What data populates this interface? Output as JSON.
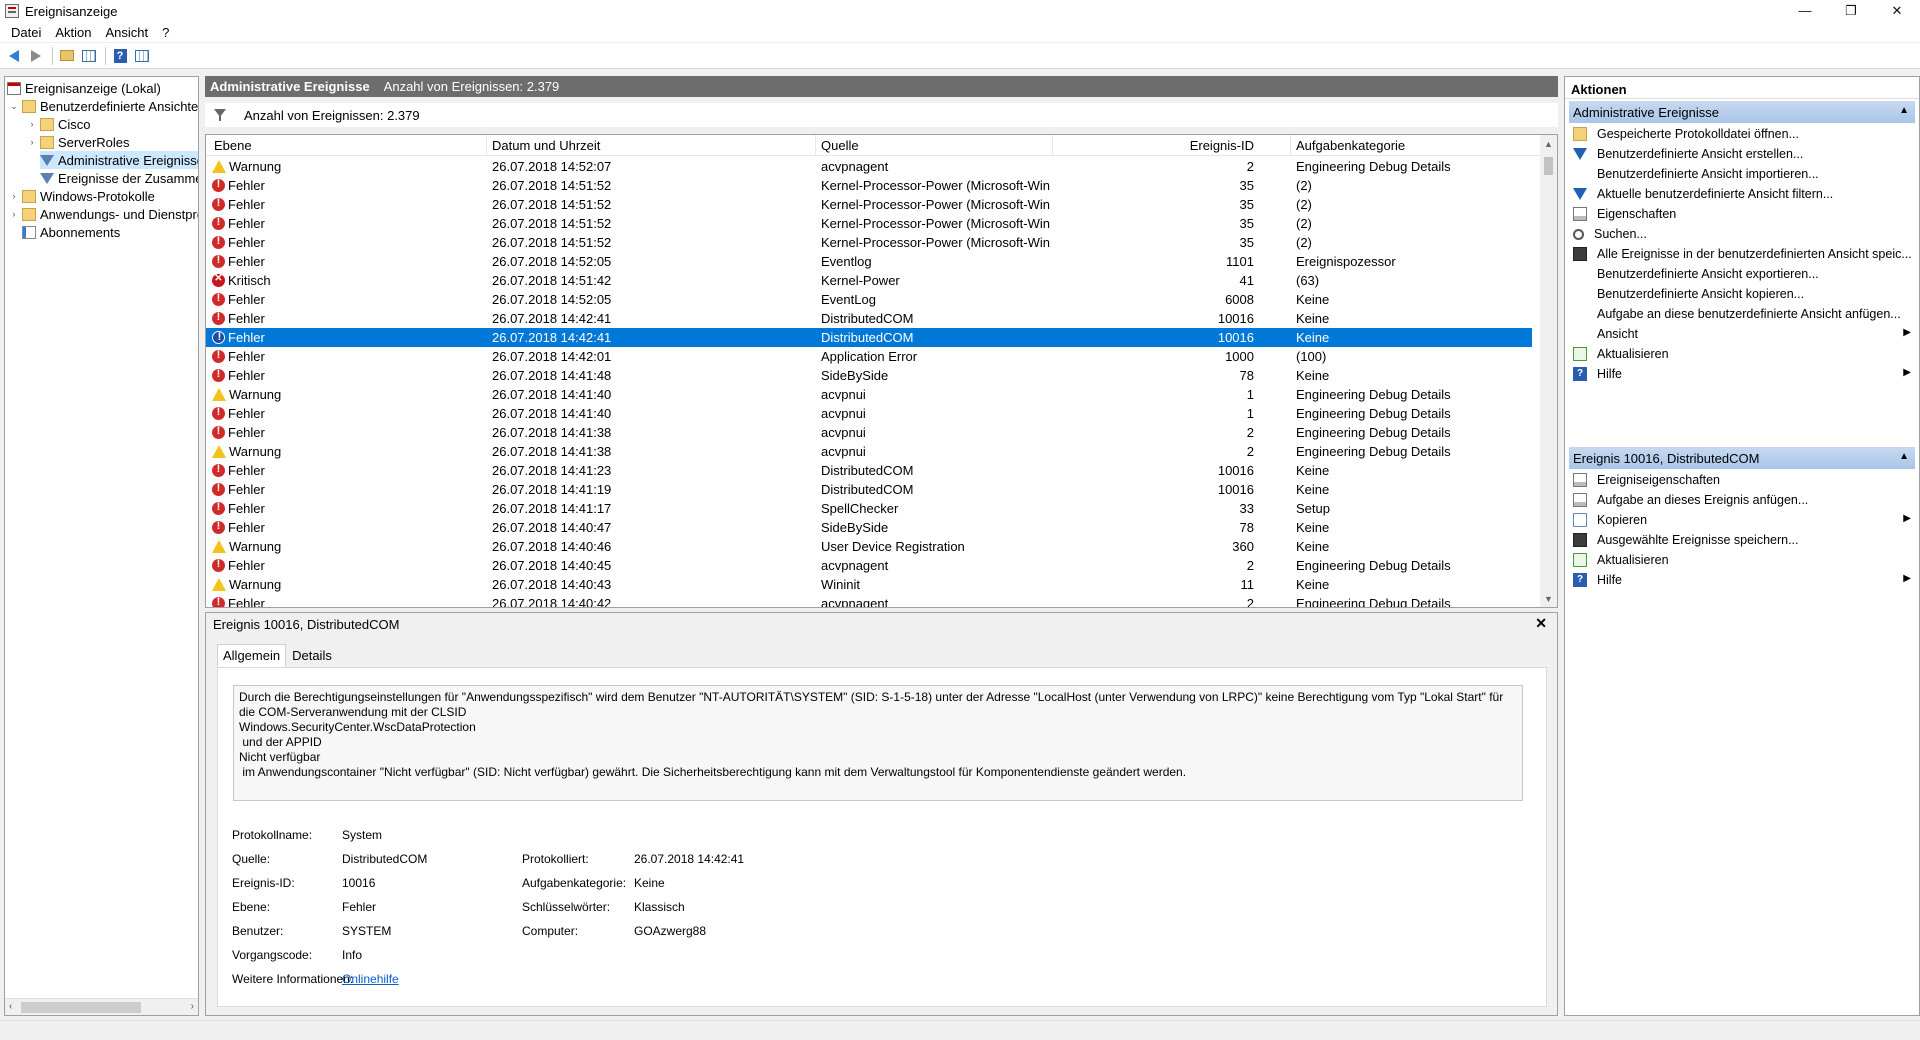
{
  "window": {
    "title": "Ereignisanzeige",
    "controls": [
      "—",
      "❐",
      "✕"
    ]
  },
  "menu": [
    "Datei",
    "Aktion",
    "Ansicht",
    "?"
  ],
  "tree": {
    "items": [
      {
        "label": "Ereignisanzeige (Lokal)",
        "icon": "event-log-icon",
        "expander": ""
      },
      {
        "label": "Benutzerdefinierte Ansichten",
        "icon": "folder-icon",
        "expander": "⌄"
      },
      {
        "label": "Cisco",
        "icon": "folder-icon",
        "expander": "›"
      },
      {
        "label": "ServerRoles",
        "icon": "folder-icon",
        "expander": "›"
      },
      {
        "label": "Administrative Ereignisse",
        "icon": "filter-icon",
        "expander": ""
      },
      {
        "label": "Ereignisse der Zusammen",
        "icon": "filter-icon",
        "expander": ""
      },
      {
        "label": "Windows-Protokolle",
        "icon": "folder-icon",
        "expander": "›"
      },
      {
        "label": "Anwendungs- und Dienstpro",
        "icon": "folder-icon",
        "expander": "›"
      },
      {
        "label": "Abonnements",
        "icon": "subscription-icon",
        "expander": ""
      }
    ]
  },
  "center": {
    "header_title": "Administrative Ereignisse",
    "header_count": "Anzahl von Ereignissen: 2.379",
    "filter_text": "Anzahl von Ereignissen: 2.379",
    "columns": [
      "Ebene",
      "Datum und Uhrzeit",
      "Quelle",
      "Ereignis-ID",
      "Aufgabenkategorie"
    ],
    "rows": [
      {
        "level": "Warnung",
        "type": "warn",
        "date": "26.07.2018 14:52:07",
        "source": "acvpnagent",
        "id": "2",
        "category": "Engineering Debug Details"
      },
      {
        "level": "Fehler",
        "type": "err",
        "date": "26.07.2018 14:51:52",
        "source": "Kernel-Processor-Power (Microsoft-Win...",
        "id": "35",
        "category": "(2)"
      },
      {
        "level": "Fehler",
        "type": "err",
        "date": "26.07.2018 14:51:52",
        "source": "Kernel-Processor-Power (Microsoft-Win...",
        "id": "35",
        "category": "(2)"
      },
      {
        "level": "Fehler",
        "type": "err",
        "date": "26.07.2018 14:51:52",
        "source": "Kernel-Processor-Power (Microsoft-Win...",
        "id": "35",
        "category": "(2)"
      },
      {
        "level": "Fehler",
        "type": "err",
        "date": "26.07.2018 14:51:52",
        "source": "Kernel-Processor-Power (Microsoft-Win...",
        "id": "35",
        "category": "(2)"
      },
      {
        "level": "Fehler",
        "type": "err",
        "date": "26.07.2018 14:52:05",
        "source": "Eventlog",
        "id": "1101",
        "category": "Ereignispozessor"
      },
      {
        "level": "Kritisch",
        "type": "crit",
        "date": "26.07.2018 14:51:42",
        "source": "Kernel-Power",
        "id": "41",
        "category": "(63)"
      },
      {
        "level": "Fehler",
        "type": "err",
        "date": "26.07.2018 14:52:05",
        "source": "EventLog",
        "id": "6008",
        "category": "Keine"
      },
      {
        "level": "Fehler",
        "type": "err",
        "date": "26.07.2018 14:42:41",
        "source": "DistributedCOM",
        "id": "10016",
        "category": "Keine"
      },
      {
        "level": "Fehler",
        "type": "err",
        "date": "26.07.2018 14:42:41",
        "source": "DistributedCOM",
        "id": "10016",
        "category": "Keine",
        "selected": true
      },
      {
        "level": "Fehler",
        "type": "err",
        "date": "26.07.2018 14:42:01",
        "source": "Application Error",
        "id": "1000",
        "category": "(100)"
      },
      {
        "level": "Fehler",
        "type": "err",
        "date": "26.07.2018 14:41:48",
        "source": "SideBySide",
        "id": "78",
        "category": "Keine"
      },
      {
        "level": "Warnung",
        "type": "warn",
        "date": "26.07.2018 14:41:40",
        "source": "acvpnui",
        "id": "1",
        "category": "Engineering Debug Details"
      },
      {
        "level": "Fehler",
        "type": "err",
        "date": "26.07.2018 14:41:40",
        "source": "acvpnui",
        "id": "1",
        "category": "Engineering Debug Details"
      },
      {
        "level": "Fehler",
        "type": "err",
        "date": "26.07.2018 14:41:38",
        "source": "acvpnui",
        "id": "2",
        "category": "Engineering Debug Details"
      },
      {
        "level": "Warnung",
        "type": "warn",
        "date": "26.07.2018 14:41:38",
        "source": "acvpnui",
        "id": "2",
        "category": "Engineering Debug Details"
      },
      {
        "level": "Fehler",
        "type": "err",
        "date": "26.07.2018 14:41:23",
        "source": "DistributedCOM",
        "id": "10016",
        "category": "Keine"
      },
      {
        "level": "Fehler",
        "type": "err",
        "date": "26.07.2018 14:41:19",
        "source": "DistributedCOM",
        "id": "10016",
        "category": "Keine"
      },
      {
        "level": "Fehler",
        "type": "err",
        "date": "26.07.2018 14:41:17",
        "source": "SpellChecker",
        "id": "33",
        "category": "Setup"
      },
      {
        "level": "Fehler",
        "type": "err",
        "date": "26.07.2018 14:40:47",
        "source": "SideBySide",
        "id": "78",
        "category": "Keine"
      },
      {
        "level": "Warnung",
        "type": "warn",
        "date": "26.07.2018 14:40:46",
        "source": "User Device Registration",
        "id": "360",
        "category": "Keine"
      },
      {
        "level": "Fehler",
        "type": "err",
        "date": "26.07.2018 14:40:45",
        "source": "acvpnagent",
        "id": "2",
        "category": "Engineering Debug Details"
      },
      {
        "level": "Warnung",
        "type": "warn",
        "date": "26.07.2018 14:40:43",
        "source": "Wininit",
        "id": "11",
        "category": "Keine"
      },
      {
        "level": "Fehler",
        "type": "err",
        "date": "26.07.2018 14:40:42",
        "source": "acvpnagent",
        "id": "2",
        "category": "Engineering Debug Details"
      }
    ]
  },
  "detail": {
    "title": "Ereignis 10016, DistributedCOM",
    "tabs": [
      "Allgemein",
      "Details"
    ],
    "description": "Durch die Berechtigungseinstellungen für \"Anwendungsspezifisch\" wird dem Benutzer \"NT-AUTORITÄT\\SYSTEM\" (SID: S-1-5-18) unter der Adresse \"LocalHost (unter Verwendung von LRPC)\" keine Berechtigung vom Typ \"Lokal Start\" für die COM-Serveranwendung mit der CLSID\nWindows.SecurityCenter.WscDataProtection\n und der APPID\nNicht verfügbar\n im Anwendungscontainer \"Nicht verfügbar\" (SID: Nicht verfügbar) gewährt. Die Sicherheitsberechtigung kann mit dem Verwaltungstool für Komponentendienste geändert werden.",
    "props": {
      "log_name_label": "Protokollname:",
      "log_name": "System",
      "source_label": "Quelle:",
      "source": "DistributedCOM",
      "logged_label": "Protokolliert:",
      "logged": "26.07.2018 14:42:41",
      "event_id_label": "Ereignis-ID:",
      "event_id": "10016",
      "task_label": "Aufgabenkategorie:",
      "task": "Keine",
      "level_label": "Ebene:",
      "level": "Fehler",
      "keywords_label": "Schlüsselwörter:",
      "keywords": "Klassisch",
      "user_label": "Benutzer:",
      "user": "SYSTEM",
      "computer_label": "Computer:",
      "computer": "GOAzwerg88",
      "opcode_label": "Vorgangscode:",
      "opcode": "Info",
      "more_label": "Weitere Informationen:",
      "more_link": "Onlinehilfe"
    }
  },
  "actions": {
    "title": "Aktionen",
    "section1": {
      "title": "Administrative Ereignisse",
      "items": [
        {
          "label": "Gespeicherte Protokolldatei öffnen...",
          "icon": "open-icon",
          "sub": false
        },
        {
          "label": "Benutzerdefinierte Ansicht erstellen...",
          "icon": "filter-icon",
          "sub": false
        },
        {
          "label": "Benutzerdefinierte Ansicht importieren...",
          "icon": "none",
          "sub": false
        },
        {
          "label": "Aktuelle benutzerdefinierte Ansicht filtern...",
          "icon": "filter-icon",
          "sub": false
        },
        {
          "label": "Eigenschaften",
          "icon": "properties-icon",
          "sub": false
        },
        {
          "label": "Suchen...",
          "icon": "search-icon",
          "sub": false
        },
        {
          "label": "Alle Ereignisse in der benutzerdefinierten Ansicht speic...",
          "icon": "save-icon",
          "sub": false
        },
        {
          "label": "Benutzerdefinierte Ansicht exportieren...",
          "icon": "none",
          "sub": false
        },
        {
          "label": "Benutzerdefinierte Ansicht kopieren...",
          "icon": "none",
          "sub": false
        },
        {
          "label": "Aufgabe an diese benutzerdefinierte Ansicht anfügen...",
          "icon": "none",
          "sub": false
        },
        {
          "label": "Ansicht",
          "icon": "none",
          "sub": true
        },
        {
          "label": "Aktualisieren",
          "icon": "refresh-icon",
          "sub": false
        },
        {
          "label": "Hilfe",
          "icon": "help-icon",
          "sub": true
        }
      ]
    },
    "section2": {
      "title": "Ereignis 10016, DistributedCOM",
      "items": [
        {
          "label": "Ereigniseigenschaften",
          "icon": "properties-icon",
          "sub": false
        },
        {
          "label": "Aufgabe an dieses Ereignis anfügen...",
          "icon": "task-icon",
          "sub": false
        },
        {
          "label": "Kopieren",
          "icon": "copy-icon",
          "sub": true
        },
        {
          "label": "Ausgewählte Ereignisse speichern...",
          "icon": "save-icon",
          "sub": false
        },
        {
          "label": "Aktualisieren",
          "icon": "refresh-icon",
          "sub": false
        },
        {
          "label": "Hilfe",
          "icon": "help-icon",
          "sub": true
        }
      ]
    }
  }
}
